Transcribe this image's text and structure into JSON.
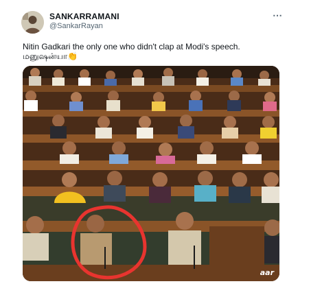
{
  "tweet": {
    "author_name": "SANKARRAMANI",
    "author_handle": "@SankarRayan",
    "text_line1": "Nitin Gadkari the only one who didn't clap at Modi's speech.",
    "text_line2": "மனுஷன்யா",
    "emoji": "👏",
    "more_icon": "⋯"
  },
  "media": {
    "description_icon": "parliament-photo",
    "watermark": "aar",
    "highlight_color": "#e8342f"
  }
}
